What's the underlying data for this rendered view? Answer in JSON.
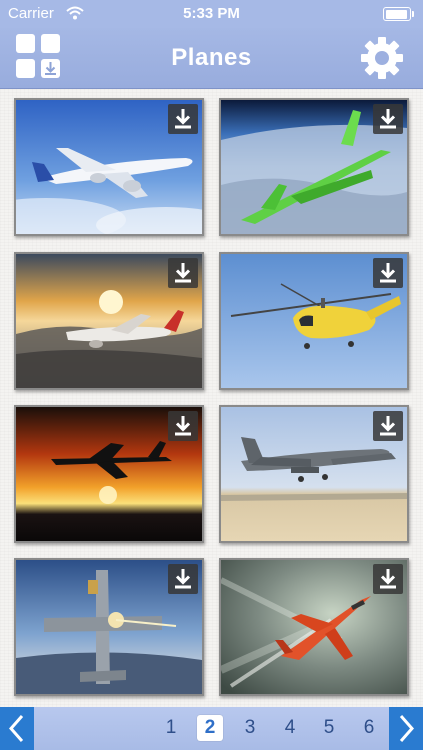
{
  "status_bar": {
    "carrier": "Carrier",
    "time": "5:33 PM"
  },
  "nav": {
    "title": "Planes",
    "left_icon": "grid-download-icon",
    "right_icon": "gear-icon"
  },
  "gallery": {
    "download_icon": "download-icon",
    "items": [
      {
        "subject": "airliner-over-clouds"
      },
      {
        "subject": "green-concept-jet"
      },
      {
        "subject": "jet-at-sunset"
      },
      {
        "subject": "yellow-rescue-helicopter"
      },
      {
        "subject": "fighter-silhouette-sunset"
      },
      {
        "subject": "bomber-takeoff"
      },
      {
        "subject": "attack-jet-firing"
      },
      {
        "subject": "red-fighter-jet"
      }
    ]
  },
  "pager": {
    "prev_icon": "chevron-left-icon",
    "next_icon": "chevron-right-icon",
    "pages": [
      "1",
      "2",
      "3",
      "4",
      "5",
      "6"
    ],
    "current": "2"
  },
  "colors": {
    "nav": "#a5b8e5",
    "arrow": "#2a7bd0"
  }
}
